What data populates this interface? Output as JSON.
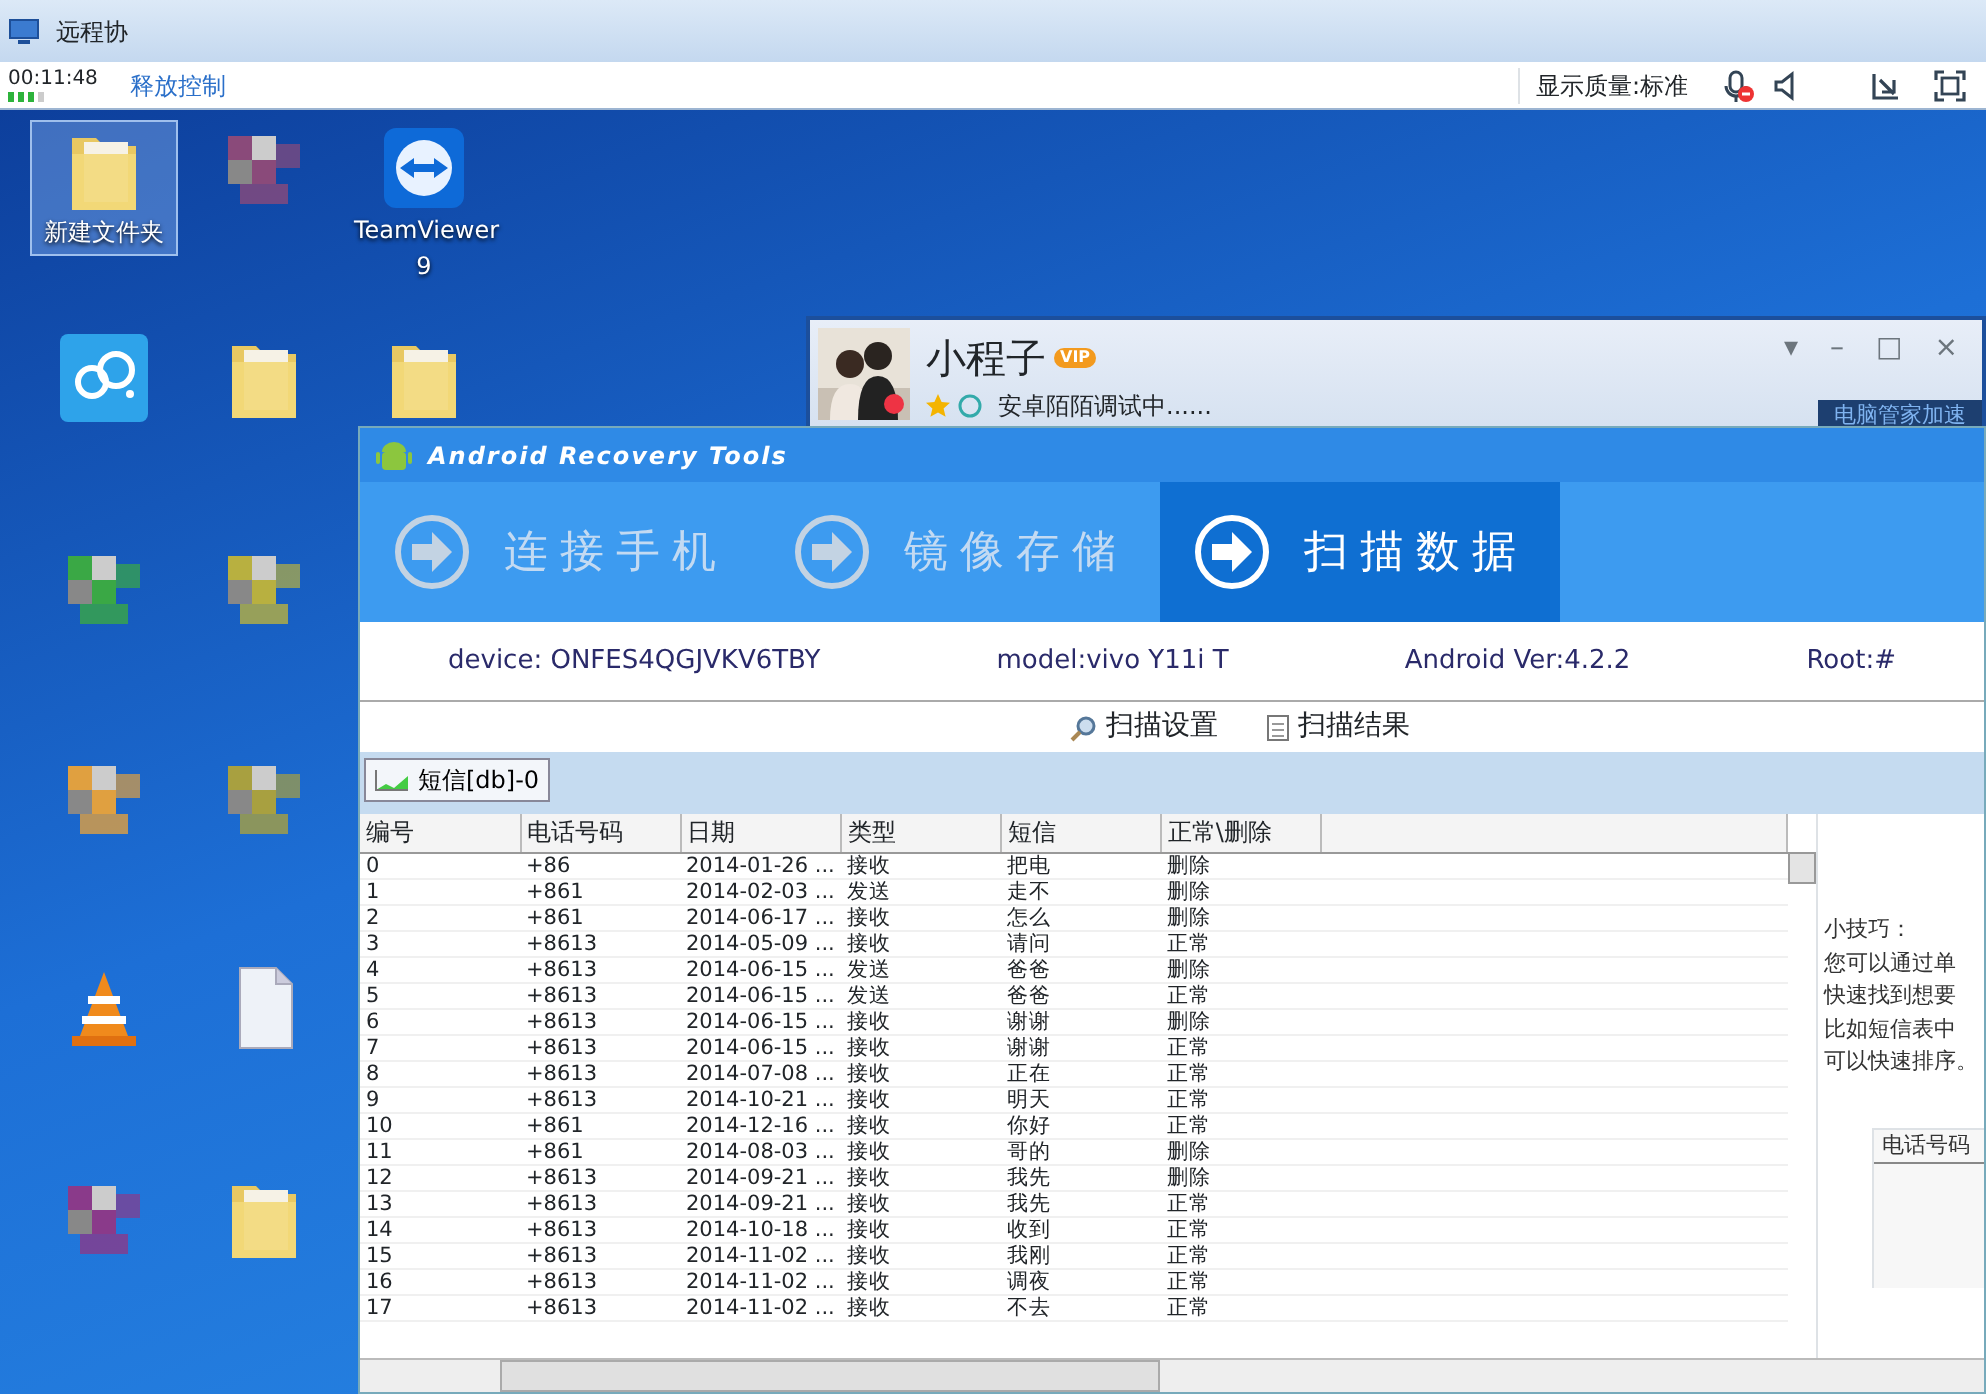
{
  "remote_bar": {
    "title": "远程协",
    "timer": "00:11:48",
    "release_control": "释放控制",
    "quality": "显示质量:标准",
    "mic_muted": true
  },
  "desktop_icons": [
    {
      "kind": "folder",
      "label": "新建文件夹",
      "selected": true
    },
    {
      "kind": "cloud",
      "selected": false
    },
    {
      "kind": "blurred",
      "color": "#3aa845",
      "selected": false
    },
    {
      "kind": "blurred",
      "color": "#e0a040",
      "selected": false
    },
    {
      "kind": "vlc",
      "selected": false
    },
    {
      "kind": "blurred",
      "color": "#8a3a8a",
      "selected": false
    },
    {
      "kind": "blurred",
      "color": "#8a4a7a",
      "selected": false
    },
    {
      "kind": "folder",
      "selected": false
    },
    {
      "kind": "blurred",
      "color": "#b8b040",
      "selected": false
    },
    {
      "kind": "blurred",
      "color": "#a8a040",
      "selected": false
    },
    {
      "kind": "file",
      "selected": false
    },
    {
      "kind": "folder",
      "selected": false
    },
    {
      "kind": "teamviewer",
      "label": "TeamViewer 9",
      "selected": false
    },
    {
      "kind": "folder",
      "selected": false
    }
  ],
  "chat_window": {
    "name": "小程子",
    "badge": "VIP",
    "status": "安卓陌陌调试中......",
    "banner": "电脑管家加速",
    "controls": [
      "▾",
      "–",
      "□",
      "×"
    ]
  },
  "app": {
    "title": "Android Recovery Tools",
    "steps": [
      {
        "label": "连接手机",
        "selected": false
      },
      {
        "label": "镜像存储",
        "selected": false
      },
      {
        "label": "扫描数据",
        "selected": true
      }
    ],
    "device_info": [
      "device: ONFES4QGJVKV6TBY",
      "model:vivo Y11i T",
      "Android Ver:4.2.2",
      "Root:#"
    ],
    "toolbar": [
      {
        "kind": "search",
        "label": "扫描设置"
      },
      {
        "kind": "doc",
        "label": "扫描结果"
      }
    ],
    "tabs": [
      {
        "label": "短信[db]-0",
        "selected": true
      }
    ],
    "table": {
      "columns": [
        "编号",
        "电话号码",
        "日期",
        "类型",
        "短信",
        "正常\\删除"
      ],
      "rows": [
        [
          "0",
          "+86",
          "2014-01-26 ...",
          "接收",
          "把电",
          "删除"
        ],
        [
          "1",
          "+861",
          "2014-02-03 ...",
          "发送",
          "走不",
          "删除"
        ],
        [
          "2",
          "+861",
          "2014-06-17 ...",
          "接收",
          "怎么",
          "删除"
        ],
        [
          "3",
          "+8613",
          "2014-05-09 ...",
          "接收",
          "请问",
          "正常"
        ],
        [
          "4",
          "+8613",
          "2014-06-15 ...",
          "发送",
          "爸爸",
          "删除"
        ],
        [
          "5",
          "+8613",
          "2014-06-15 ...",
          "发送",
          "爸爸",
          "正常"
        ],
        [
          "6",
          "+8613",
          "2014-06-15 ...",
          "接收",
          "谢谢",
          "删除"
        ],
        [
          "7",
          "+8613",
          "2014-06-15 ...",
          "接收",
          "谢谢",
          "正常"
        ],
        [
          "8",
          "+8613",
          "2014-07-08 ...",
          "接收",
          "正在",
          "正常"
        ],
        [
          "9",
          "+8613",
          "2014-10-21 ...",
          "接收",
          "明天",
          "正常"
        ],
        [
          "10",
          "+861",
          "2014-12-16 ...",
          "接收",
          "你好",
          "正常"
        ],
        [
          "11",
          "+861",
          "2014-08-03 ...",
          "接收",
          "哥的",
          "删除"
        ],
        [
          "12",
          "+8613",
          "2014-09-21 ...",
          "接收",
          "我先",
          "删除"
        ],
        [
          "13",
          "+8613",
          "2014-09-21 ...",
          "接收",
          "我先",
          "正常"
        ],
        [
          "14",
          "+8613",
          "2014-10-18 ...",
          "接收",
          "收到",
          "正常"
        ],
        [
          "15",
          "+8613",
          "2014-11-02 ...",
          "接收",
          "我刚",
          "正常"
        ],
        [
          "16",
          "+8613",
          "2014-11-02 ...",
          "接收",
          "调夜",
          "正常"
        ],
        [
          "17",
          "+8613",
          "2014-11-02 ...",
          "接收",
          "不去",
          "正常"
        ]
      ]
    },
    "tip": {
      "title": "小技巧：",
      "lines": [
        "您可以通过单",
        "快速找到想要",
        "比如短信表中",
        "可以快速排序。"
      ],
      "example_header": "电话号码"
    }
  }
}
